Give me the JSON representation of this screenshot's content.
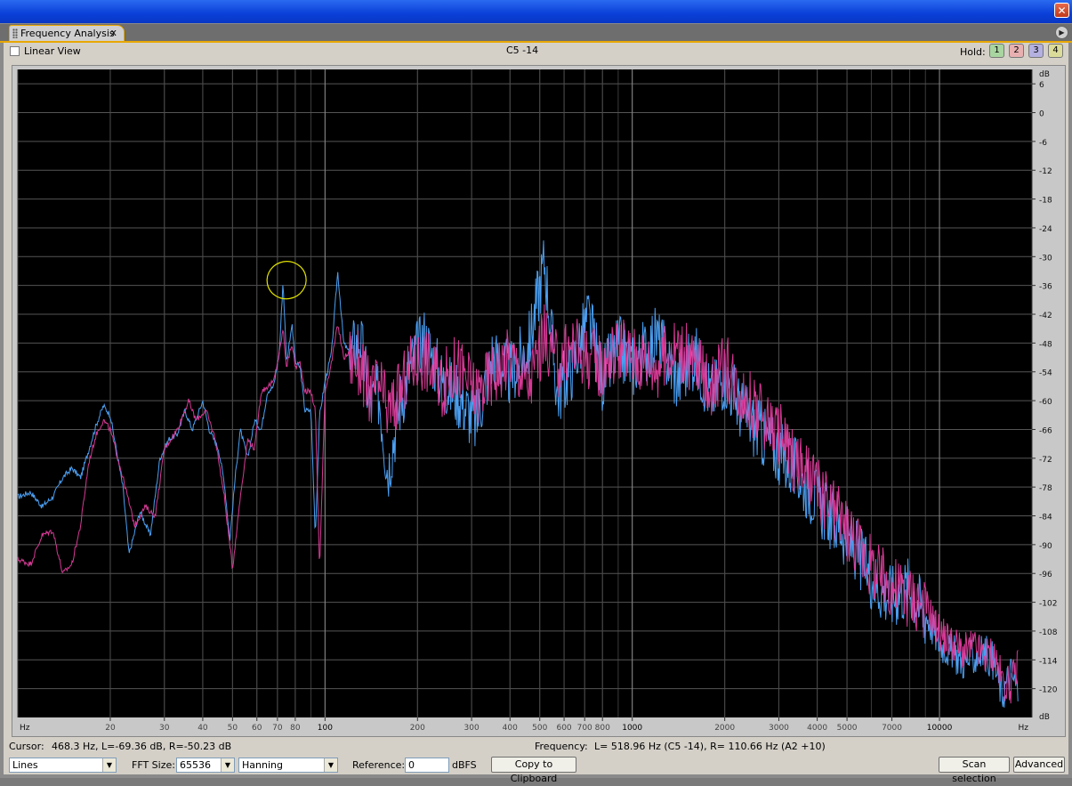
{
  "window": {
    "close_glyph": "✕"
  },
  "tab": {
    "label": "Frequency Analysis",
    "close_glyph": "x",
    "menu_glyph": "▶"
  },
  "header": {
    "linear_view_label": "Linear View",
    "linear_view_checked": false,
    "note_readout": "C5 -14",
    "hold_label": "Hold:",
    "hold_buttons": [
      {
        "label": "1",
        "color": "#a9d6a0"
      },
      {
        "label": "2",
        "color": "#e8b0b0"
      },
      {
        "label": "3",
        "color": "#b4b0e0"
      },
      {
        "label": "4",
        "color": "#dcdc9a"
      }
    ]
  },
  "status": {
    "cursor_label": "Cursor:",
    "cursor_value": "468.3 Hz, L=-69.36 dB, R=-50.23 dB",
    "frequency_label": "Frequency:",
    "frequency_value": "L= 518.96 Hz (C5 -14), R= 110.66 Hz (A2 +10)"
  },
  "controls": {
    "display_mode": "Lines",
    "fft_label": "FFT Size:",
    "fft_size": "65536",
    "window_function": "Hanning",
    "reference_label": "Reference:",
    "reference_value": "0",
    "reference_unit": "dBFS",
    "copy_button": "Copy to Clipboard",
    "scan_button": "Scan selection",
    "advanced_button": "Advanced"
  },
  "chart_data": {
    "type": "line",
    "x_scale": "log",
    "xlim": [
      10,
      20000
    ],
    "ylim": [
      -126,
      9
    ],
    "x_unit_label": "Hz",
    "y_unit_label": "dB",
    "x_ticks": [
      20,
      30,
      40,
      50,
      60,
      70,
      80,
      100,
      200,
      300,
      400,
      500,
      600,
      700,
      800,
      1000,
      2000,
      3000,
      4000,
      5000,
      7000,
      10000
    ],
    "x_tick_labels": [
      "20",
      "30",
      "40",
      "50",
      "60",
      "70",
      "80",
      "100",
      "200",
      "300",
      "400",
      "500",
      "600",
      "700",
      "800",
      "1000",
      "2000",
      "3000",
      "4000",
      "5000",
      "7000",
      "10000"
    ],
    "y_ticks": [
      6,
      0,
      -6,
      -12,
      -18,
      -24,
      -30,
      -36,
      -42,
      -48,
      -54,
      -60,
      -66,
      -72,
      -78,
      -84,
      -90,
      -96,
      -102,
      -108,
      -114,
      -120
    ],
    "y_tick_labels": [
      "6",
      "0",
      "-6",
      "-12",
      "-18",
      "-24",
      "-30",
      "-36",
      "-42",
      "-48",
      "-54",
      "-60",
      "-66",
      "-72",
      "-78",
      "-84",
      "-90",
      "-96",
      "-102",
      "-108",
      "-114",
      "-120"
    ],
    "grid": true,
    "background": "#000000",
    "annotation": {
      "shape": "hand-drawn circle",
      "color": "#e0e000",
      "around_x": 73,
      "around_y": -36
    },
    "series": [
      {
        "channel": "R",
        "color": "#4fa8ff",
        "points": [
          [
            10,
            -80
          ],
          [
            11,
            -79
          ],
          [
            12,
            -82
          ],
          [
            13,
            -80
          ],
          [
            14,
            -76
          ],
          [
            15,
            -74
          ],
          [
            16,
            -76
          ],
          [
            18,
            -65
          ],
          [
            19,
            -61
          ],
          [
            20,
            -63
          ],
          [
            22,
            -78
          ],
          [
            23,
            -92
          ],
          [
            25,
            -83
          ],
          [
            27,
            -88
          ],
          [
            29,
            -72
          ],
          [
            31,
            -68
          ],
          [
            33,
            -67
          ],
          [
            35,
            -62
          ],
          [
            37,
            -66
          ],
          [
            40,
            -60
          ],
          [
            42,
            -66
          ],
          [
            45,
            -70
          ],
          [
            47,
            -77
          ],
          [
            49,
            -89
          ],
          [
            51,
            -76
          ],
          [
            53,
            -66
          ],
          [
            56,
            -72
          ],
          [
            59,
            -64
          ],
          [
            62,
            -66
          ],
          [
            65,
            -58
          ],
          [
            68,
            -57
          ],
          [
            71,
            -50
          ],
          [
            73,
            -35
          ],
          [
            75,
            -52
          ],
          [
            78,
            -44
          ],
          [
            80,
            -52
          ],
          [
            83,
            -53
          ],
          [
            86,
            -62
          ],
          [
            90,
            -62
          ],
          [
            93,
            -88
          ],
          [
            96,
            -63
          ],
          [
            100,
            -56
          ],
          [
            105,
            -50
          ],
          [
            110,
            -33
          ],
          [
            115,
            -48
          ],
          [
            120,
            -50
          ],
          [
            130,
            -46
          ],
          [
            140,
            -60
          ],
          [
            150,
            -58
          ],
          [
            160,
            -74
          ],
          [
            175,
            -60
          ],
          [
            190,
            -52
          ],
          [
            210,
            -46
          ],
          [
            240,
            -55
          ],
          [
            270,
            -58
          ],
          [
            310,
            -64
          ],
          [
            350,
            -50
          ],
          [
            400,
            -54
          ],
          [
            460,
            -48
          ],
          [
            518,
            -30
          ],
          [
            570,
            -58
          ],
          [
            640,
            -52
          ],
          [
            720,
            -42
          ],
          [
            800,
            -55
          ],
          [
            900,
            -48
          ],
          [
            1000,
            -52
          ],
          [
            1200,
            -46
          ],
          [
            1400,
            -55
          ],
          [
            1600,
            -50
          ],
          [
            1800,
            -58
          ],
          [
            2000,
            -54
          ],
          [
            2300,
            -62
          ],
          [
            2600,
            -66
          ],
          [
            3000,
            -70
          ],
          [
            3400,
            -74
          ],
          [
            3800,
            -78
          ],
          [
            4200,
            -82
          ],
          [
            4800,
            -86
          ],
          [
            5500,
            -92
          ],
          [
            6300,
            -98
          ],
          [
            7000,
            -100
          ],
          [
            8000,
            -98
          ],
          [
            9000,
            -104
          ],
          [
            10000,
            -110
          ],
          [
            11000,
            -112
          ],
          [
            12000,
            -114
          ],
          [
            13000,
            -113
          ],
          [
            14000,
            -112
          ],
          [
            15000,
            -114
          ],
          [
            16000,
            -121
          ],
          [
            17000,
            -116
          ],
          [
            18000,
            -120
          ]
        ]
      },
      {
        "channel": "L",
        "color": "#e03c9c",
        "points": [
          [
            10,
            -93
          ],
          [
            11,
            -94
          ],
          [
            12,
            -88
          ],
          [
            13,
            -87
          ],
          [
            14,
            -96
          ],
          [
            15,
            -94
          ],
          [
            16,
            -86
          ],
          [
            17,
            -73
          ],
          [
            18,
            -67
          ],
          [
            19,
            -64
          ],
          [
            20,
            -66
          ],
          [
            22,
            -76
          ],
          [
            24,
            -86
          ],
          [
            26,
            -82
          ],
          [
            28,
            -84
          ],
          [
            30,
            -70
          ],
          [
            33,
            -66
          ],
          [
            36,
            -60
          ],
          [
            38,
            -64
          ],
          [
            41,
            -62
          ],
          [
            44,
            -68
          ],
          [
            47,
            -80
          ],
          [
            50,
            -95
          ],
          [
            53,
            -80
          ],
          [
            56,
            -68
          ],
          [
            59,
            -70
          ],
          [
            62,
            -58
          ],
          [
            65,
            -57
          ],
          [
            68,
            -56
          ],
          [
            71,
            -50
          ],
          [
            73,
            -45
          ],
          [
            75,
            -53
          ],
          [
            78,
            -48
          ],
          [
            80,
            -53
          ],
          [
            83,
            -52
          ],
          [
            86,
            -58
          ],
          [
            90,
            -58
          ],
          [
            93,
            -62
          ],
          [
            96,
            -95
          ],
          [
            100,
            -58
          ],
          [
            105,
            -52
          ],
          [
            110,
            -44
          ],
          [
            115,
            -51
          ],
          [
            120,
            -50
          ],
          [
            130,
            -52
          ],
          [
            140,
            -58
          ],
          [
            150,
            -56
          ],
          [
            160,
            -62
          ],
          [
            175,
            -58
          ],
          [
            190,
            -52
          ],
          [
            210,
            -50
          ],
          [
            240,
            -56
          ],
          [
            270,
            -52
          ],
          [
            310,
            -58
          ],
          [
            350,
            -54
          ],
          [
            400,
            -50
          ],
          [
            460,
            -56
          ],
          [
            518,
            -46
          ],
          [
            570,
            -52
          ],
          [
            640,
            -48
          ],
          [
            720,
            -50
          ],
          [
            800,
            -52
          ],
          [
            900,
            -48
          ],
          [
            1000,
            -50
          ],
          [
            1200,
            -52
          ],
          [
            1400,
            -48
          ],
          [
            1600,
            -52
          ],
          [
            1800,
            -56
          ],
          [
            2000,
            -52
          ],
          [
            2300,
            -58
          ],
          [
            2600,
            -62
          ],
          [
            3000,
            -66
          ],
          [
            3400,
            -72
          ],
          [
            3800,
            -76
          ],
          [
            4200,
            -80
          ],
          [
            4800,
            -84
          ],
          [
            5500,
            -90
          ],
          [
            6300,
            -96
          ],
          [
            7000,
            -98
          ],
          [
            8000,
            -100
          ],
          [
            9000,
            -102
          ],
          [
            10000,
            -108
          ],
          [
            11000,
            -110
          ],
          [
            12000,
            -112
          ],
          [
            13000,
            -111
          ],
          [
            14000,
            -113
          ],
          [
            15000,
            -112
          ],
          [
            16000,
            -118
          ],
          [
            17000,
            -119
          ],
          [
            18000,
            -115
          ]
        ]
      }
    ]
  }
}
